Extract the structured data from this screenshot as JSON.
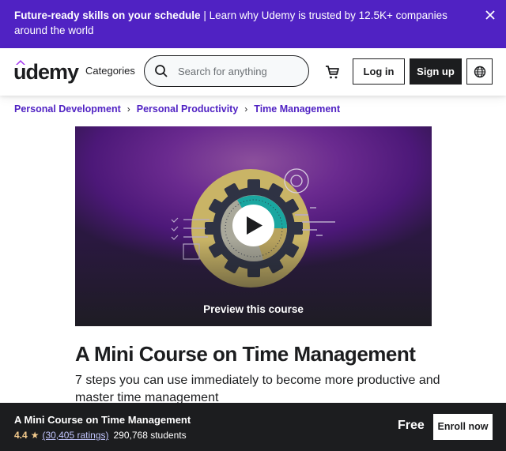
{
  "banner": {
    "headline": "Future-ready skills on your schedule",
    "separator": " | ",
    "message": "Learn why Udemy is trusted by 12.5K+ companies around the world",
    "close_icon": "close-icon"
  },
  "header": {
    "logo_text": "udemy",
    "categories_label": "Categories",
    "search": {
      "placeholder": "Search for anything",
      "value": "",
      "icon": "search-icon"
    },
    "cart_icon": "cart-icon",
    "login_label": "Log in",
    "signup_label": "Sign up",
    "language_icon": "globe-icon"
  },
  "breadcrumb": {
    "items": [
      "Personal Development",
      "Personal Productivity",
      "Time Management"
    ],
    "separator": "›"
  },
  "preview": {
    "label": "Preview this course",
    "play_icon": "play-icon"
  },
  "course": {
    "title": "A Mini Course on Time Management",
    "subtitle": "7 steps you can use immediately to become more productive and master time management"
  },
  "bottom_bar": {
    "title": "A Mini Course on Time Management",
    "rating": "4.4",
    "star_icon": "star-icon",
    "ratings_count": "(30,405 ratings)",
    "students": "290,768 students",
    "price": "Free",
    "enroll_label": "Enroll now"
  },
  "colors": {
    "brand_purple": "#5022c3",
    "dark": "#1c1d1f",
    "rating_gold": "#f3ca8c",
    "link_lavender": "#c0c4fc",
    "logo_hat": "#a435f0"
  }
}
